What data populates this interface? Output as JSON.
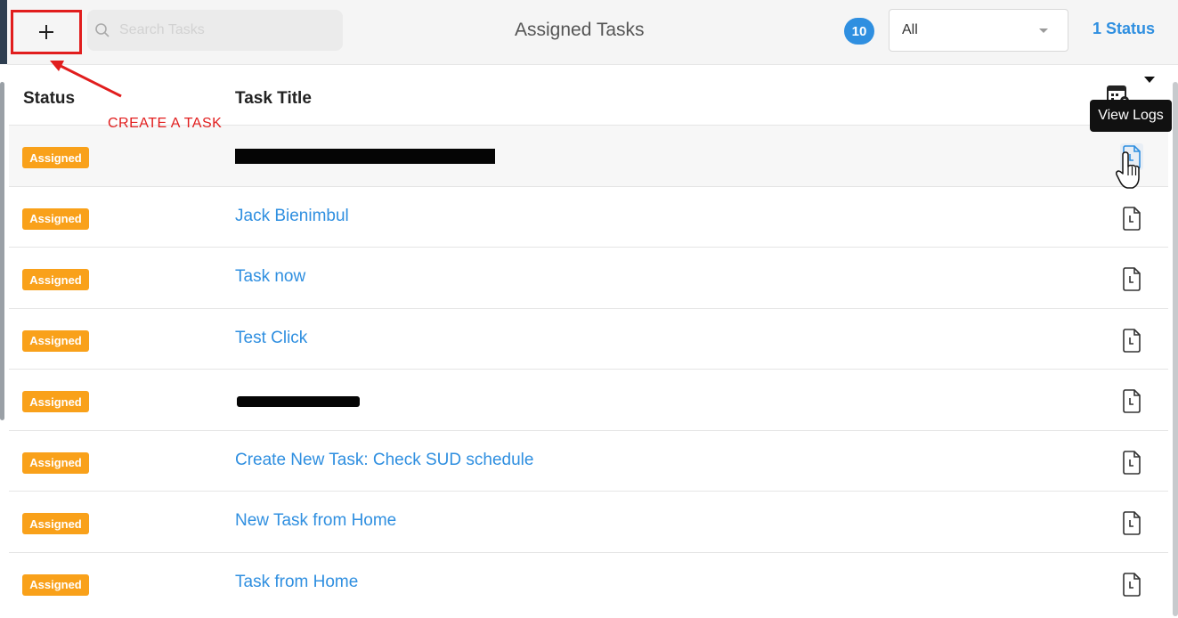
{
  "header": {
    "add_label": "+",
    "search_placeholder": "Search Tasks",
    "title": "Assigned Tasks",
    "count": "10",
    "filter_value": "All",
    "status_link": "1 Status"
  },
  "table": {
    "columns": [
      "Status",
      "Task Title"
    ],
    "tooltip": "View Logs",
    "rows": [
      {
        "status": "Assigned",
        "title": ""
      },
      {
        "status": "Assigned",
        "title": "Jack Bienimbul"
      },
      {
        "status": "Assigned",
        "title": "Task now"
      },
      {
        "status": "Assigned",
        "title": "Test Click"
      },
      {
        "status": "Assigned",
        "title": ""
      },
      {
        "status": "Assigned",
        "title": "Create New Task: Check SUD schedule"
      },
      {
        "status": "Assigned",
        "title": "New Task from Home"
      },
      {
        "status": "Assigned",
        "title": "Task from Home"
      }
    ]
  },
  "annotation": {
    "text": "CREATE A TASK",
    "color": "#e11d1d"
  },
  "colors": {
    "accent": "#2f8fe0",
    "badge": "#f9a11a"
  },
  "icons": {
    "add": "plus-icon",
    "search": "search-icon",
    "calendar": "calendar-settings-icon",
    "log": "document-clock-icon"
  }
}
